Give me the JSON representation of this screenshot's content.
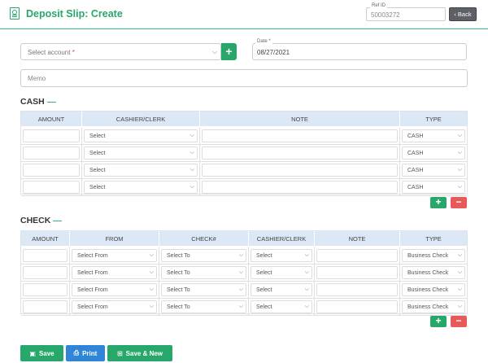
{
  "header": {
    "title": "Deposit Slip: Create",
    "ref_label": "Ref ID",
    "ref_value": "50003272",
    "back_label": "Back"
  },
  "form": {
    "account_placeholder": "Select account",
    "account_required": "*",
    "date_label": "Date *",
    "date_value": "08/27/2021",
    "memo_placeholder": "Memo"
  },
  "cash": {
    "title": "CASH",
    "headers": [
      "AMOUNT",
      "CASHIER/CLERK",
      "NOTE",
      "TYPE"
    ],
    "rows": [
      {
        "cashier": "Select",
        "type": "CASH"
      },
      {
        "cashier": "Select",
        "type": "CASH"
      },
      {
        "cashier": "Select",
        "type": "CASH"
      },
      {
        "cashier": "Select",
        "type": "CASH"
      }
    ],
    "add_label": "+",
    "remove_label": "−"
  },
  "check": {
    "title": "CHECK",
    "headers": [
      "AMOUNT",
      "FROM",
      "CHECK#",
      "CASHIER/CLERK",
      "NOTE",
      "TYPE"
    ],
    "rows": [
      {
        "from": "Select From",
        "check": "Select To",
        "cashier": "Select",
        "type": "Business Check"
      },
      {
        "from": "Select From",
        "check": "Select To",
        "cashier": "Select",
        "type": "Business Check"
      },
      {
        "from": "Select From",
        "check": "Select To",
        "cashier": "Select",
        "type": "Business Check"
      },
      {
        "from": "Select From",
        "check": "Select To",
        "cashier": "Select",
        "type": "Business Check"
      }
    ],
    "add_label": "+",
    "remove_label": "−"
  },
  "actions": {
    "save": "Save",
    "print": "Print",
    "save_new": "Save & New"
  },
  "icons": {
    "title": "deposit-slip-icon",
    "back": "chevron-left-icon",
    "save": "floppy-disk-icon",
    "print": "printer-icon",
    "save_new": "plus-square-icon"
  },
  "colors": {
    "accent": "#27a76a",
    "print": "#2f86d9",
    "danger": "#e85a5a",
    "header_bg": "#dce8f6"
  }
}
